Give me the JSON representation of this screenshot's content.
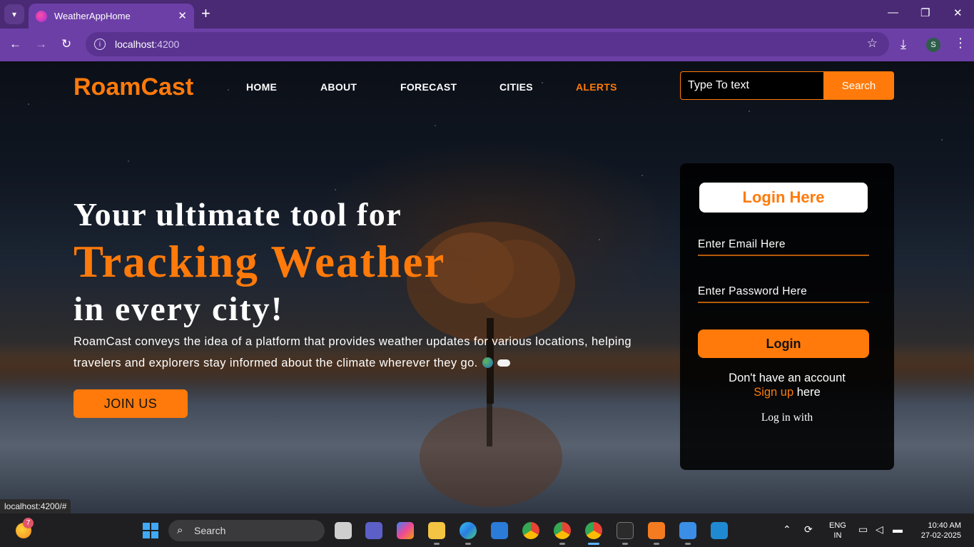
{
  "browser": {
    "tab_title": "WeatherAppHome",
    "url_host": "localhost",
    "url_port": ":4200",
    "profile_initial": "S"
  },
  "header": {
    "logo": "RoamCast",
    "nav": [
      {
        "label": "HOME",
        "active": false
      },
      {
        "label": "ABOUT",
        "active": false
      },
      {
        "label": "FORECAST",
        "active": false
      },
      {
        "label": "CITIES",
        "active": false
      },
      {
        "label": "ALERTS",
        "active": true
      }
    ],
    "search_placeholder": "Type To text",
    "search_button": "Search"
  },
  "hero": {
    "line1": "Your ultimate tool for",
    "line2": "Tracking Weather",
    "line3": "in every city!",
    "description": "RoamCast conveys the idea of a platform that provides weather updates for various locations, helping travelers and explorers stay informed about the climate wherever they go.",
    "cta": "JOIN US"
  },
  "login": {
    "title": "Login Here",
    "email_placeholder": "Enter Email Here",
    "password_placeholder": "Enter Password Here",
    "button": "Login",
    "no_account": "Don't have an account",
    "signup_link": "Sign up",
    "signup_suffix": " here",
    "log_in_with": "Log in with"
  },
  "status_url": "localhost:4200/#",
  "taskbar": {
    "weather_badge": "7",
    "search_label": "Search",
    "lang_top": "ENG",
    "lang_bottom": "IN",
    "time": "10:40 AM",
    "date": "27-02-2025"
  },
  "colors": {
    "accent": "#ff7a0a",
    "browser_frame": "#6c3fa6"
  }
}
